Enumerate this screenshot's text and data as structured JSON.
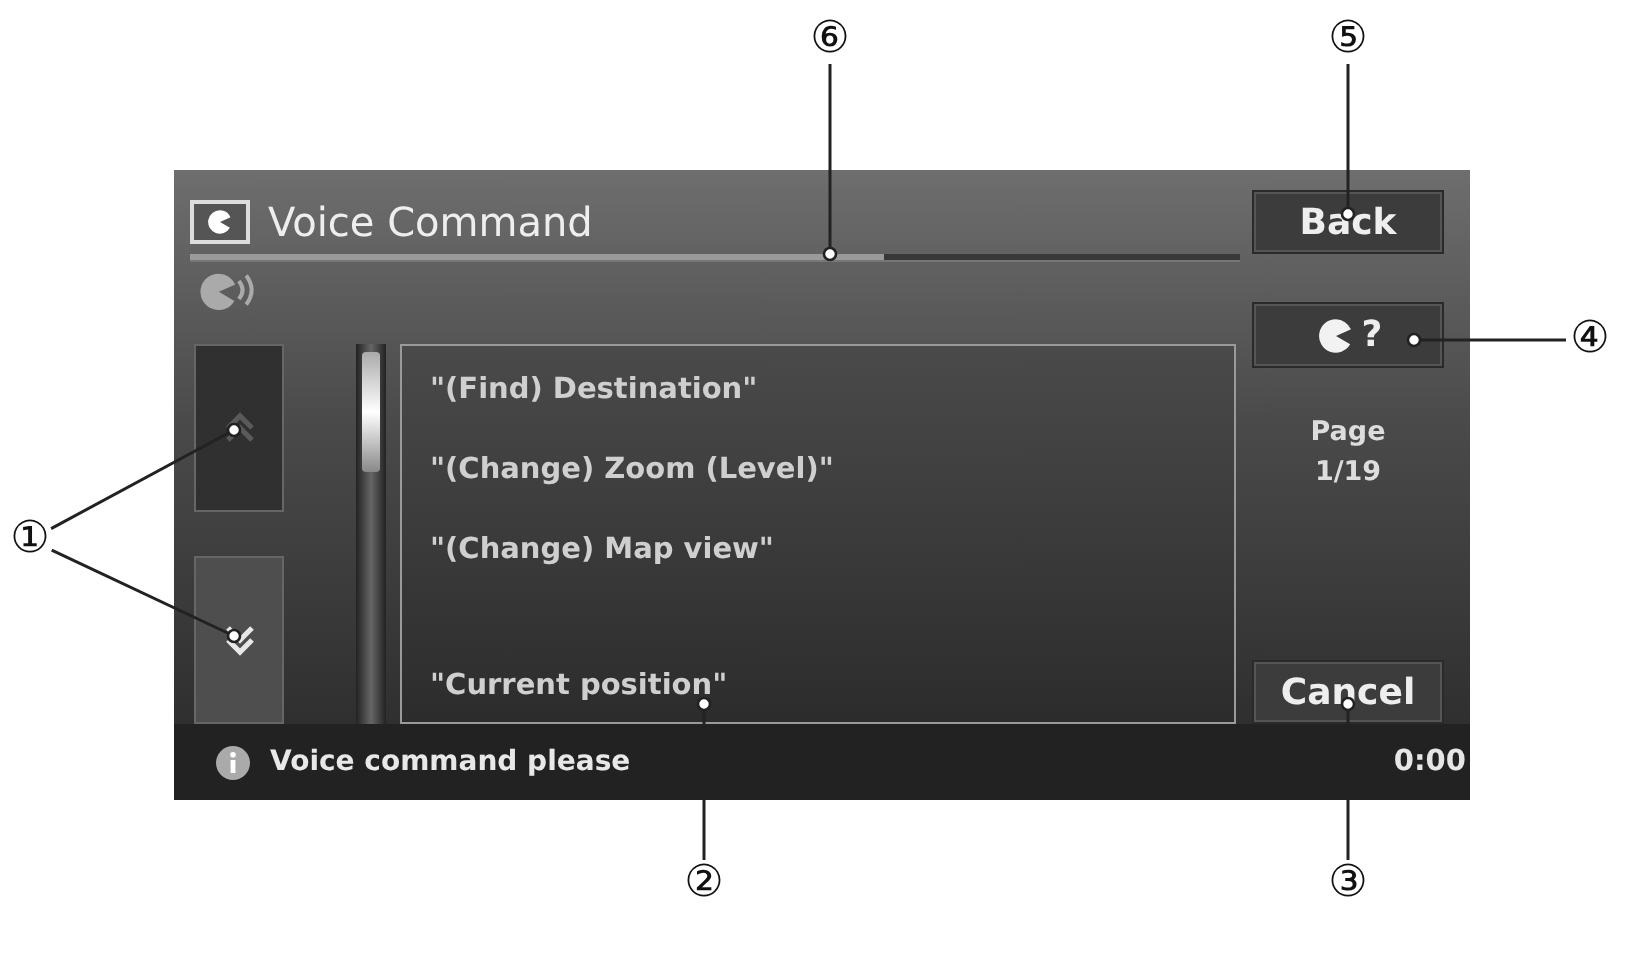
{
  "screen": {
    "title": "Voice Command",
    "progress": {
      "level": 0.66
    },
    "back_button": "Back",
    "help_button": "?",
    "scroll_up": {
      "disabled": true
    },
    "scroll_down": {
      "disabled": false
    },
    "list_items": [
      {
        "text": "\"(Find) Destination\"",
        "kind": "command"
      },
      {
        "text": "\"(Change) Zoom (Level)\"",
        "kind": "command"
      },
      {
        "text": "\"(Change) Map view\"",
        "kind": "command"
      },
      {
        "kind": "blank"
      },
      {
        "text": "\"Current position\"",
        "kind": "command"
      }
    ],
    "page_label": "Page",
    "page_number": "1/19",
    "cancel_button": "Cancel",
    "status_message": "Voice command please",
    "clock": "0:00"
  },
  "callouts": [
    {
      "label": "⑥"
    },
    {
      "label": "⑤"
    },
    {
      "label": "④"
    },
    {
      "label": "①"
    },
    {
      "label": "②"
    },
    {
      "label": "③"
    }
  ]
}
